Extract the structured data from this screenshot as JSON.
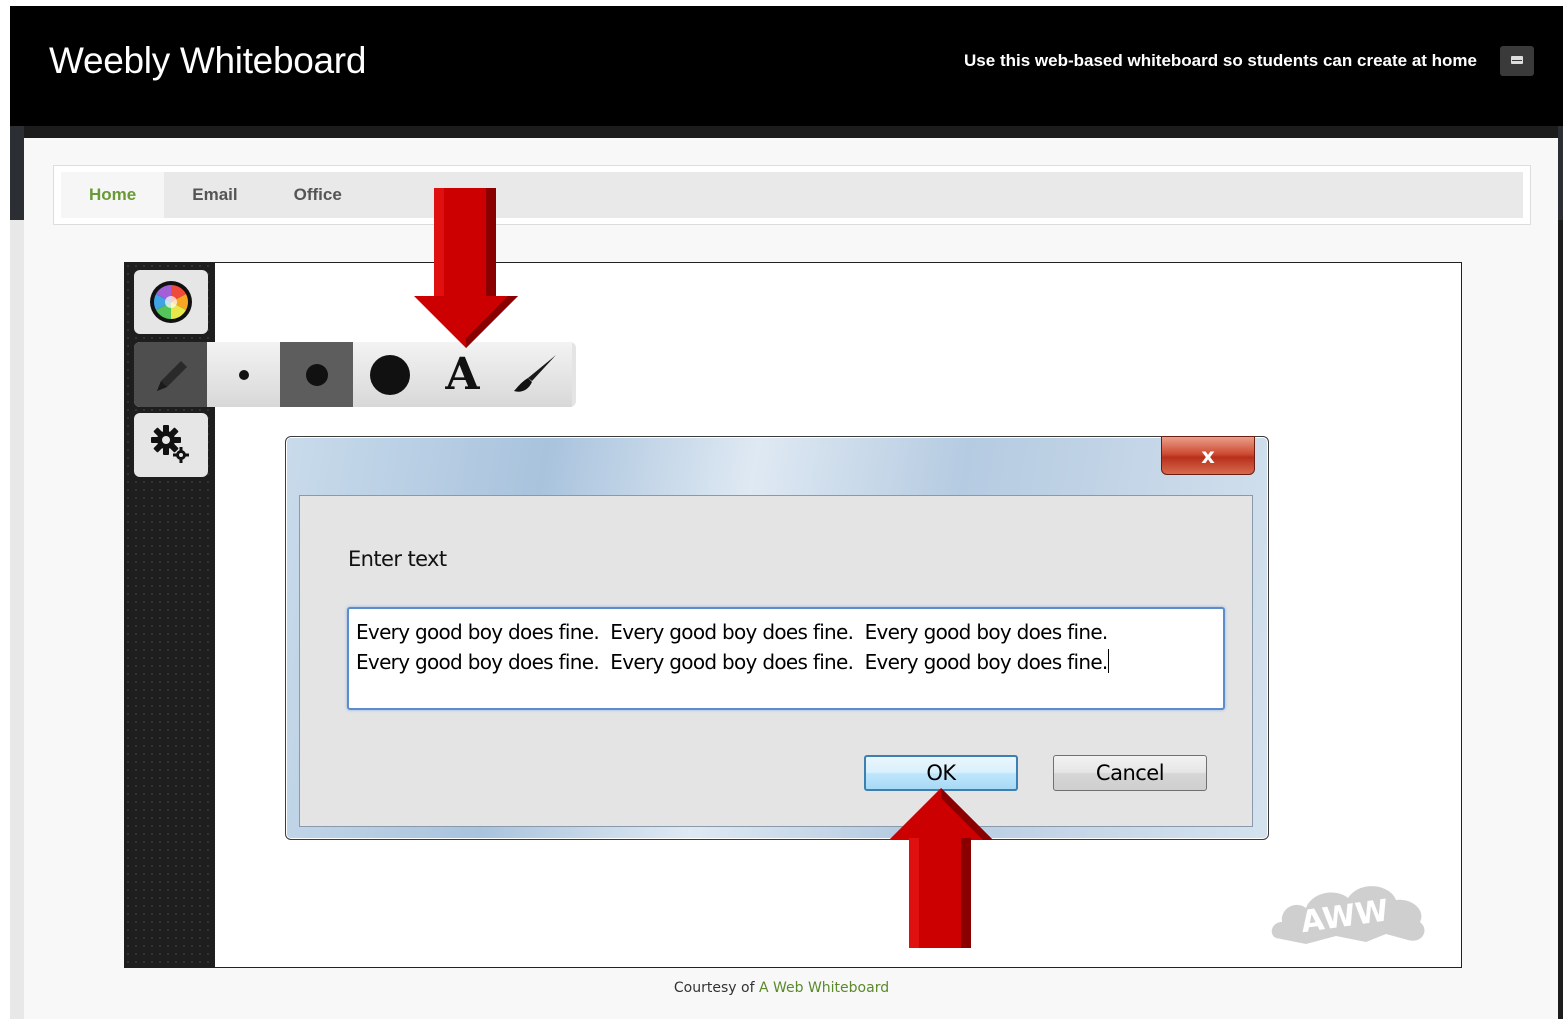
{
  "header": {
    "title": "Weebly Whiteboard",
    "tagline": "Use this web-based whiteboard so students can create at home",
    "mail_icon": "mail-icon"
  },
  "nav": {
    "items": [
      {
        "label": "Home",
        "active": true
      },
      {
        "label": "Email",
        "active": false
      },
      {
        "label": "Office",
        "active": false
      }
    ]
  },
  "toolbar": {
    "tools": [
      "color-wheel-icon",
      "pencil-icon",
      "small-dot-icon",
      "medium-dot-icon",
      "large-dot-icon",
      "text-tool-icon",
      "brush-icon",
      "settings-icon"
    ],
    "text_tool_glyph": "A"
  },
  "dialog": {
    "close_label": "x",
    "prompt": "Enter text",
    "input_value": "Every good boy does fine.  Every good boy does fine.  Every good boy does fine.\nEvery good boy does fine.  Every good boy does fine.  Every good boy does fine.",
    "ok_label": "OK",
    "cancel_label": "Cancel"
  },
  "watermark": "AWW",
  "footer": {
    "prefix": "Courtesy of ",
    "link": "A Web Whiteboard"
  },
  "colors": {
    "nav_active": "#6a9a35",
    "arrow": "#cc0000",
    "input_border": "#5b8ccc"
  }
}
